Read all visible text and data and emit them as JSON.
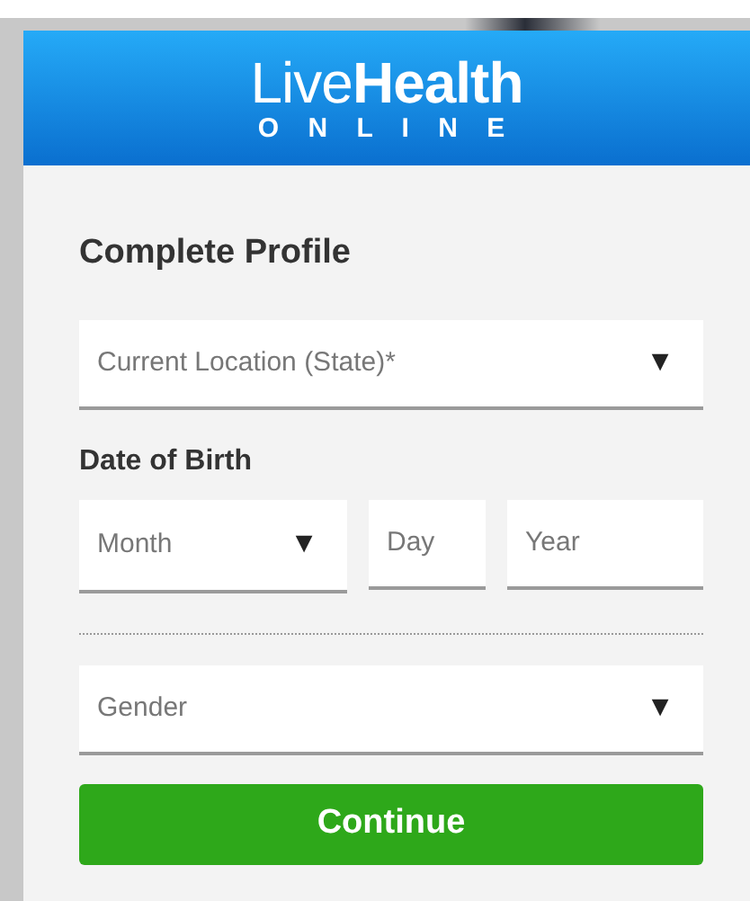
{
  "header": {
    "logo_light": "Live",
    "logo_bold": "Health",
    "logo_sub": "O N L I N E"
  },
  "title": "Complete Profile",
  "location": {
    "kind": "select",
    "placeholder": "Current Location (State)*",
    "arrow": "▼"
  },
  "dob": {
    "label": "Date of Birth",
    "fields": [
      {
        "kind": "select",
        "placeholder": "Month",
        "arrow": "▼"
      },
      {
        "kind": "text",
        "placeholder": "Day"
      },
      {
        "kind": "text",
        "placeholder": "Year"
      }
    ]
  },
  "gender": {
    "kind": "select",
    "placeholder": "Gender",
    "arrow": "▼"
  },
  "continue_button": "Continue"
}
